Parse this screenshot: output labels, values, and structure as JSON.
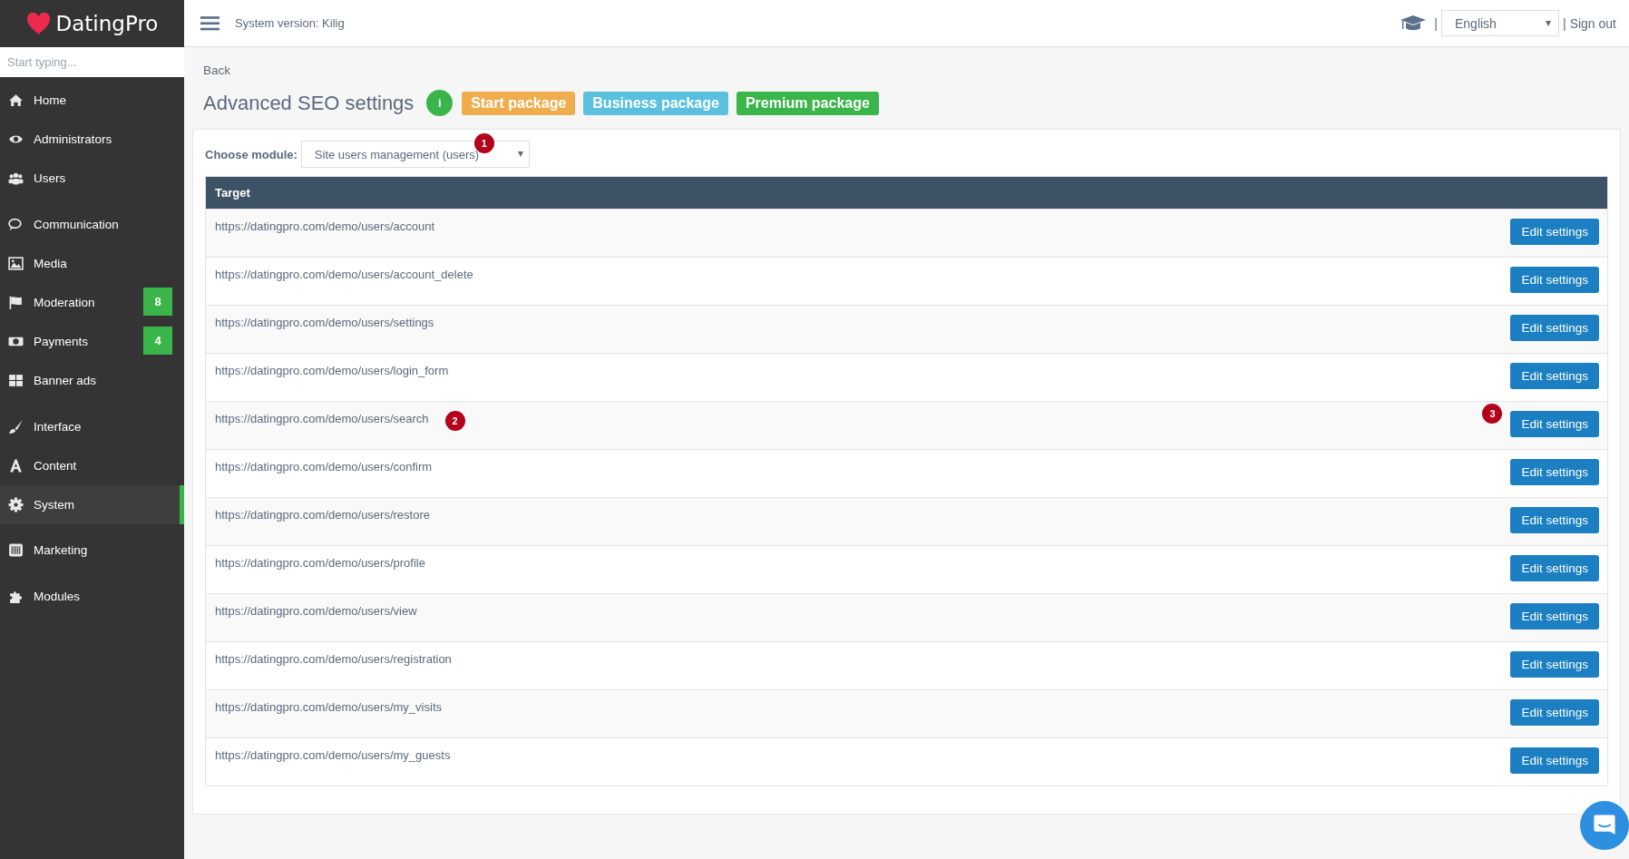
{
  "brand": {
    "name": "DatingPro"
  },
  "sidebar": {
    "search": {
      "placeholder": "Start typing..."
    },
    "items": [
      {
        "label": "Home",
        "selected": false
      },
      {
        "label": "Administrators",
        "selected": false
      },
      {
        "label": "Users",
        "selected": false
      },
      {
        "label": "Communication",
        "selected": false
      },
      {
        "label": "Media",
        "selected": false
      },
      {
        "label": "Moderation",
        "selected": false,
        "badge": "8"
      },
      {
        "label": "Payments",
        "selected": false,
        "badge": "4"
      },
      {
        "label": "Banner ads",
        "selected": false
      },
      {
        "label": "Interface",
        "selected": false
      },
      {
        "label": "Content",
        "selected": false
      },
      {
        "label": "System",
        "selected": true
      },
      {
        "label": "Marketing",
        "selected": false
      },
      {
        "label": "Modules",
        "selected": false
      }
    ]
  },
  "header": {
    "version": "System version: Kilig",
    "separator_1": "|",
    "language": "English",
    "separator_2": "|",
    "sign_out": "Sign out"
  },
  "page": {
    "back": "Back",
    "title": "Advanced SEO settings",
    "info": "i",
    "packages": [
      {
        "label": "Start package",
        "color": "#f0ad4e"
      },
      {
        "label": "Business package",
        "color": "#5bc0de"
      },
      {
        "label": "Premium package",
        "color": "#3ab54a"
      }
    ]
  },
  "module": {
    "label": "Choose module:",
    "value": "Site users management (users)",
    "marker": "1"
  },
  "table": {
    "columns": [
      "Target"
    ],
    "rows": [
      {
        "target": "https://datingpro.com/demo/users/account",
        "button": "Edit settings"
      },
      {
        "target": "https://datingpro.com/demo/users/account_delete",
        "button": "Edit settings"
      },
      {
        "target": "https://datingpro.com/demo/users/settings",
        "button": "Edit settings"
      },
      {
        "target": "https://datingpro.com/demo/users/login_form",
        "button": "Edit settings"
      },
      {
        "target": "https://datingpro.com/demo/users/search",
        "button": "Edit settings",
        "target_marker": "2",
        "button_marker": "3"
      },
      {
        "target": "https://datingpro.com/demo/users/confirm",
        "button": "Edit settings"
      },
      {
        "target": "https://datingpro.com/demo/users/restore",
        "button": "Edit settings"
      },
      {
        "target": "https://datingpro.com/demo/users/profile",
        "button": "Edit settings"
      },
      {
        "target": "https://datingpro.com/demo/users/view",
        "button": "Edit settings"
      },
      {
        "target": "https://datingpro.com/demo/users/registration",
        "button": "Edit settings"
      },
      {
        "target": "https://datingpro.com/demo/users/my_visits",
        "button": "Edit settings"
      },
      {
        "target": "https://datingpro.com/demo/users/my_guests",
        "button": "Edit settings"
      }
    ]
  }
}
